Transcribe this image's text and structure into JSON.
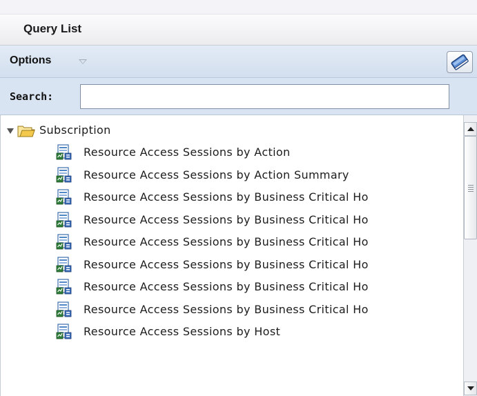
{
  "panel": {
    "title": "Query List"
  },
  "toolbar": {
    "options_label": "Options",
    "options_icon": "chevron-down-icon",
    "action_icon": "book-icon"
  },
  "search": {
    "label": "Search:",
    "value": "",
    "placeholder": ""
  },
  "tree": {
    "folder": {
      "label": "Subscription",
      "icon": "folder-open-icon",
      "expanded": true
    },
    "items": [
      {
        "label": "Resource Access Sessions by Action",
        "icon": "report-icon"
      },
      {
        "label": "Resource Access Sessions by Action Summary",
        "icon": "report-icon"
      },
      {
        "label": "Resource Access Sessions by Business Critical Ho",
        "icon": "report-icon"
      },
      {
        "label": "Resource Access Sessions by Business Critical Ho",
        "icon": "report-icon"
      },
      {
        "label": "Resource Access Sessions by Business Critical Ho",
        "icon": "report-icon"
      },
      {
        "label": "Resource Access Sessions by Business Critical Ho",
        "icon": "report-icon"
      },
      {
        "label": "Resource Access Sessions by Business Critical Ho",
        "icon": "report-icon"
      },
      {
        "label": "Resource Access Sessions by Business Critical Ho",
        "icon": "report-icon"
      },
      {
        "label": "Resource Access Sessions by Host",
        "icon": "report-icon"
      }
    ]
  },
  "colors": {
    "options_bar": "#d3dfef",
    "search_bar": "#d9e4f2",
    "folder": "#f2c94c"
  }
}
